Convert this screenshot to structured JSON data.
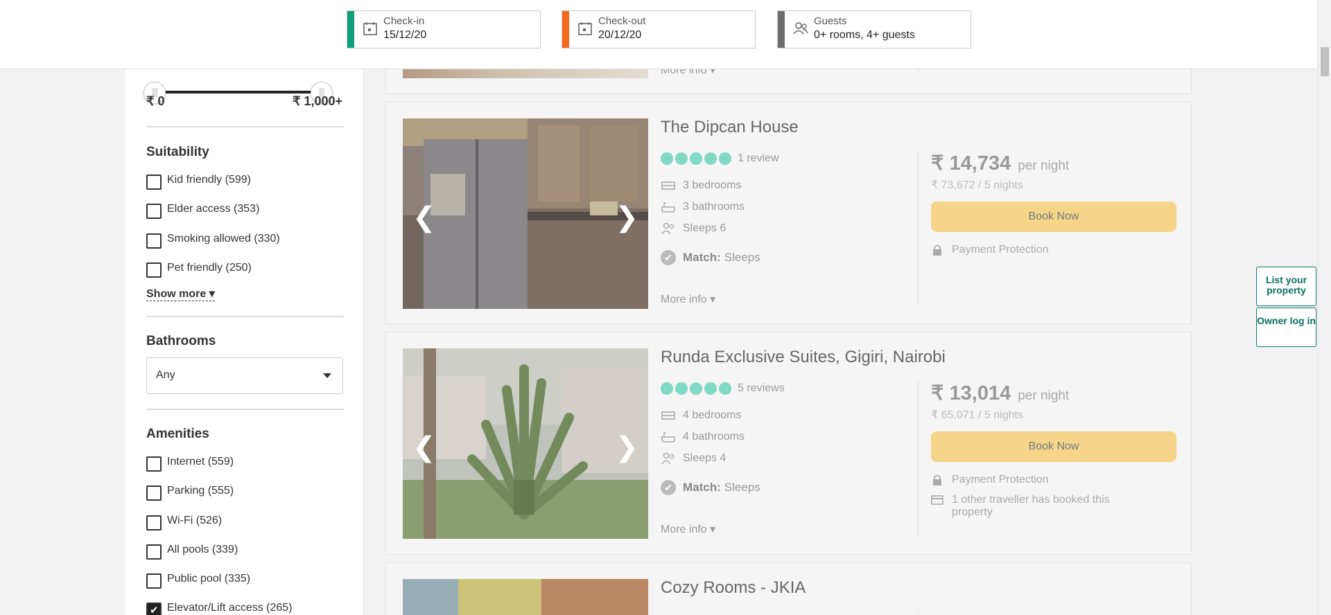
{
  "header": {
    "checkin": {
      "label": "Check-in",
      "value": "15/12/20",
      "color": "#0fa07a"
    },
    "checkout": {
      "label": "Check-out",
      "value": "20/12/20",
      "color": "#f26a1b"
    },
    "guests": {
      "label": "Guests",
      "value": "0+ rooms, 4+ guests",
      "color": "#6d6d6d"
    }
  },
  "sidebar": {
    "price": {
      "min": "₹ 0",
      "max": "₹ 1,000+"
    },
    "suitability": {
      "title": "Suitability",
      "items": [
        {
          "label": "Kid friendly (599)",
          "checked": false
        },
        {
          "label": "Elder access (353)",
          "checked": false
        },
        {
          "label": "Smoking allowed (330)",
          "checked": false
        },
        {
          "label": "Pet friendly (250)",
          "checked": false
        }
      ],
      "show_more": "Show more"
    },
    "bathrooms": {
      "title": "Bathrooms",
      "value": "Any"
    },
    "amenities": {
      "title": "Amenities",
      "items": [
        {
          "label": "Internet (559)",
          "checked": false
        },
        {
          "label": "Parking (555)",
          "checked": false
        },
        {
          "label": "Wi-Fi (526)",
          "checked": false
        },
        {
          "label": "All pools (339)",
          "checked": false
        },
        {
          "label": "Public pool (335)",
          "checked": false
        },
        {
          "label": "Elevator/Lift access (265)",
          "checked": true
        }
      ]
    }
  },
  "listings": [
    {
      "more_info": "More info"
    },
    {
      "title": "The Dipcan House",
      "reviews": "1 review",
      "bedrooms": "3 bedrooms",
      "bathrooms": "3 bathrooms",
      "sleeps": "Sleeps 6",
      "match_label": "Match:",
      "match_value": "Sleeps",
      "more_info": "More info",
      "price": "₹ 14,734",
      "per_night": "per night",
      "total": "₹ 73,672 / 5 nights",
      "book": "Book Now",
      "protection": "Payment Protection"
    },
    {
      "title": "Runda Exclusive Suites, Gigiri, Nairobi",
      "reviews": "5 reviews",
      "bedrooms": "4 bedrooms",
      "bathrooms": "4 bathrooms",
      "sleeps": "Sleeps 4",
      "match_label": "Match:",
      "match_value": "Sleeps",
      "more_info": "More info",
      "price": "₹ 13,014",
      "per_night": "per night",
      "total": "₹ 65,071 / 5 nights",
      "book": "Book Now",
      "protection": "Payment Protection",
      "booked_note": "1 other traveller has booked this property"
    },
    {
      "title": "Cozy Rooms - JKIA"
    }
  ],
  "float": {
    "list_property": "List your property",
    "owner_login": "Owner log in"
  }
}
